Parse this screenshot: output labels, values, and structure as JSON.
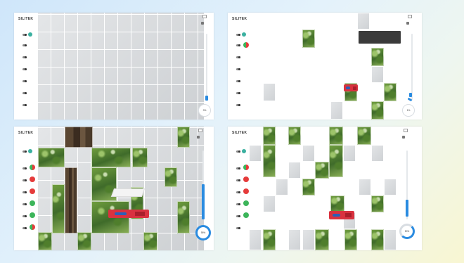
{
  "panels": [
    {
      "title": "SILITEK",
      "subtitle": "",
      "checkbox1": "",
      "checkbox2": "",
      "gauge": "0%",
      "slider_text": "",
      "tooltip": ""
    },
    {
      "title": "SILITEK",
      "subtitle": "",
      "checkbox1": "",
      "checkbox2": "",
      "gauge": "1%",
      "slider_text": "",
      "tooltip": ""
    },
    {
      "title": "SILITEK",
      "subtitle": "",
      "checkbox1": "",
      "checkbox2": "",
      "gauge": "95%",
      "slider_text": "",
      "tooltip": ""
    },
    {
      "title": "SILITEK",
      "subtitle": "",
      "checkbox1": "",
      "checkbox2": "",
      "gauge": "50%",
      "slider_text": "",
      "tooltip": ""
    }
  ],
  "row_labels": [
    "",
    "",
    "",
    "",
    "",
    "",
    ""
  ],
  "colors": {
    "accent": "#2a8be0",
    "red": "#e53b3b",
    "green": "#3cb55a",
    "tile_gray": "#d8dadc"
  },
  "icons": [
    "toggle-icon",
    "status-dot-icon",
    "gear-icon",
    "checkbox-icon"
  ],
  "gauge_levels": [
    0,
    0.01,
    0.95,
    0.5
  ],
  "slider_levels": [
    0.05,
    0.1,
    0.55,
    0.25
  ]
}
